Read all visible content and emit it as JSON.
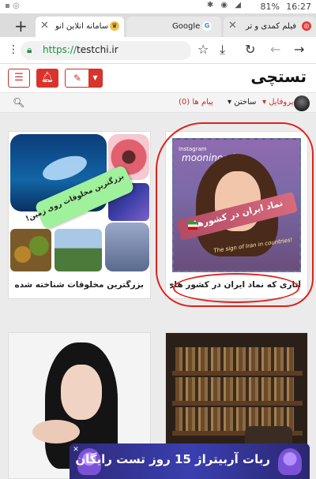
{
  "status_bar": {
    "time": "16:27",
    "battery": "81%"
  },
  "tabs": [
    {
      "title": "سامانه آنلاین انو",
      "active": true
    },
    {
      "title": "Google",
      "active": false
    },
    {
      "title": "فیلم کمدی و تر",
      "active": false
    }
  ],
  "address_bar": {
    "scheme": "https://",
    "host": "testchi.ir"
  },
  "site": {
    "logo": "تستچی",
    "nav": {
      "profile": "پروفایل",
      "create": "ساختن",
      "messages": "پیام ها (0)"
    }
  },
  "cards": [
    {
      "caption": "بزرگترین مخلوقات شناخته شده روی زمین!",
      "banner": "بزرگترین مخلوقات روی زمین!"
    },
    {
      "caption": "آثاری که نماد ایران در کشور های...",
      "poster_tag": "Instagram",
      "poster_brand": "mooninood",
      "poster_title": "نماد ایران در کشورها!",
      "poster_sub": "The sign of Iran in countries!"
    }
  ],
  "ad": {
    "text": "ربات آربیتراژ 15 روز تست رایگان"
  },
  "colors": {
    "accent": "#d9342b",
    "annotation": "#e0201a",
    "secure": "#1e8e3e"
  }
}
